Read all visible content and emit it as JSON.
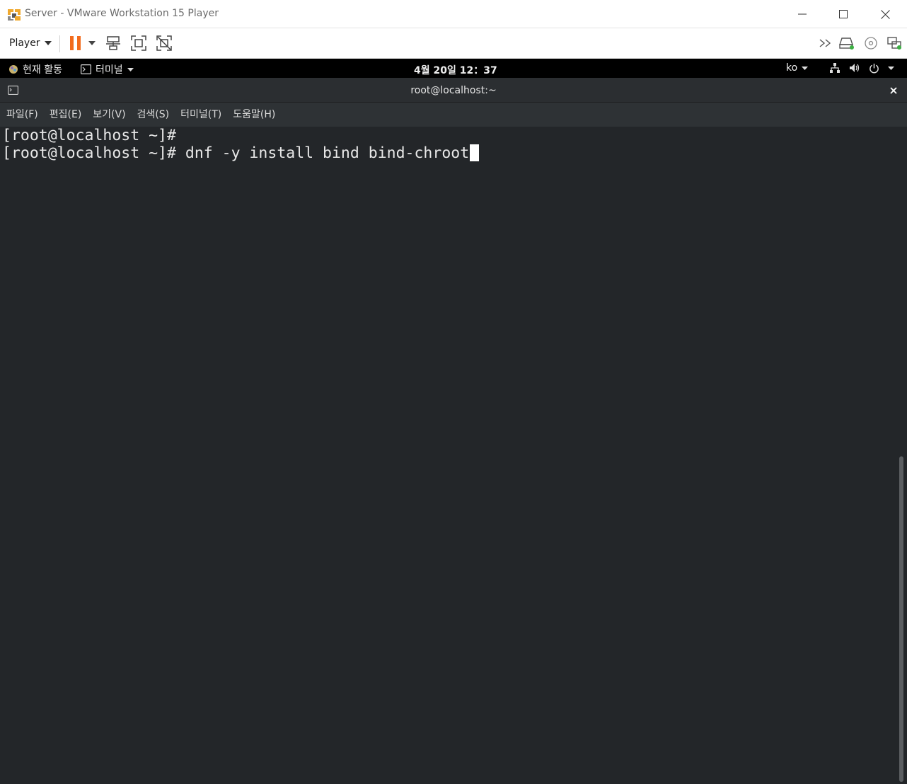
{
  "window": {
    "title": "Server - VMware Workstation 15 Player"
  },
  "toolbar": {
    "player_label": "Player",
    "icons": [
      "pause-icon",
      "send-ctrl-alt-del-icon",
      "fullscreen-icon",
      "unity-icon",
      "double-chevron-right-icon",
      "hard-disk-icon",
      "cd-dvd-icon",
      "network-adapter-icon"
    ],
    "accent_color": "#f26b1d"
  },
  "gnome_topbar": {
    "activities_label": "현재 활동",
    "app_menu_label": "터미널",
    "clock": "4월 20일  12：37",
    "lang": "ko"
  },
  "terminal": {
    "title": "root@localhost:~",
    "menu": [
      "파일(F)",
      "편집(E)",
      "보기(V)",
      "검색(S)",
      "터미널(T)",
      "도움말(H)"
    ],
    "lines": [
      "[root@localhost ~]#",
      "[root@localhost ~]# dnf -y install bind bind-chroot"
    ],
    "background_color": "#232629"
  }
}
